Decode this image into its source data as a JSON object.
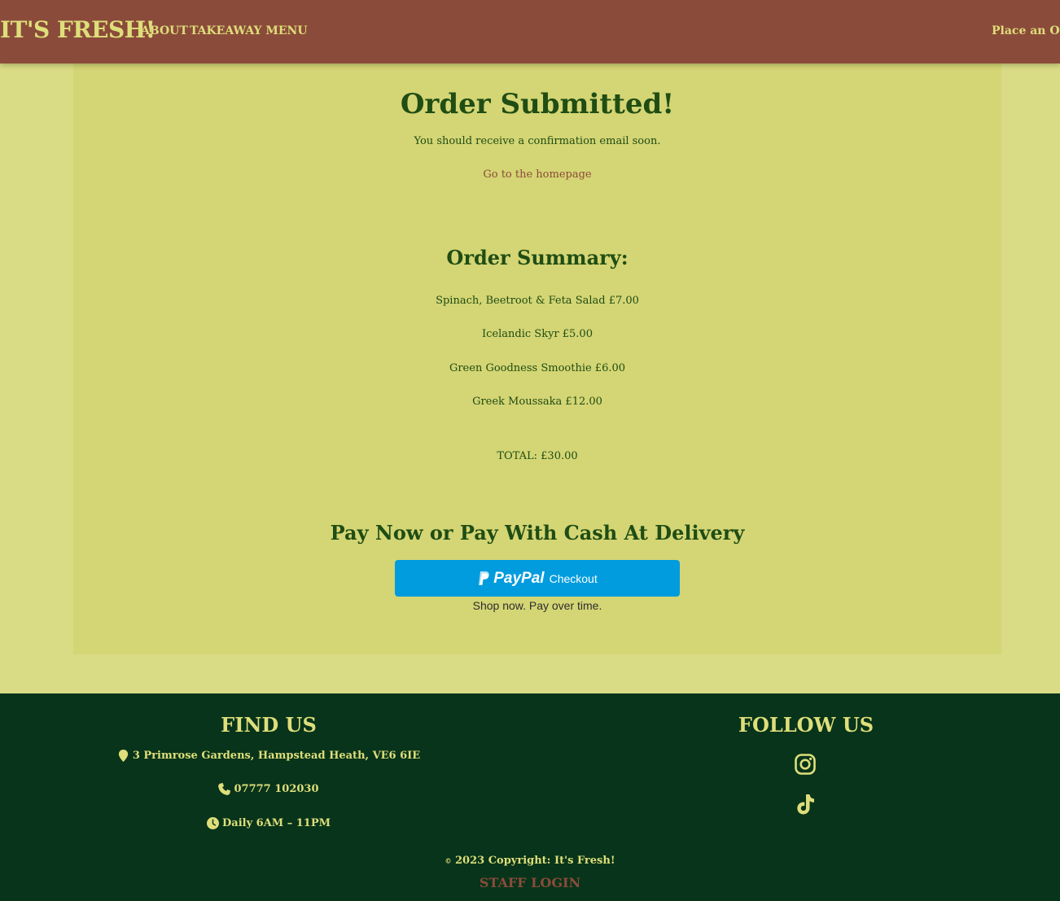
{
  "navbar": {
    "brand": "IT'S FRESH!",
    "links": [
      "ABOUT",
      "TAKEAWAY MENU"
    ],
    "order_button": "Place an Order"
  },
  "confirmation": {
    "title": "Order Submitted!",
    "message": "You should receive a confirmation email soon.",
    "home_link": "Go to the homepage"
  },
  "summary": {
    "title": "Order Summary:",
    "items": [
      "Spinach, Beetroot & Feta Salad £7.00",
      "Icelandic Skyr £5.00",
      "Green Goodness Smoothie £6.00",
      "Greek Moussaka £12.00"
    ],
    "total": "TOTAL: £30.00"
  },
  "payment": {
    "title": "Pay Now or Pay With Cash At Delivery",
    "paypal_brand": "PayPal",
    "paypal_button": "Checkout",
    "paypal_tagline": "Shop now. Pay over time."
  },
  "footer": {
    "find_us_title": "FIND US",
    "address": "3 Primrose Gardens, Hampstead Heath, VE6 6IE",
    "phone": "07777 102030",
    "hours": "Daily 6AM – 11PM",
    "follow_us_title": "FOLLOW US",
    "social": [
      "instagram-icon",
      "tiktok-icon"
    ],
    "copyright_symbol": "©",
    "copyright": "2023 Copyright: It's Fresh!",
    "staff_login": "STAFF LOGIN"
  },
  "colors": {
    "background": "#dadb85",
    "panel": "#d4d574",
    "navbar": "#8b4b3a",
    "footer": "#07341a",
    "text_green": "#1f4d14",
    "accent_yellow": "#dede7a",
    "paypal_blue": "#009cde"
  }
}
